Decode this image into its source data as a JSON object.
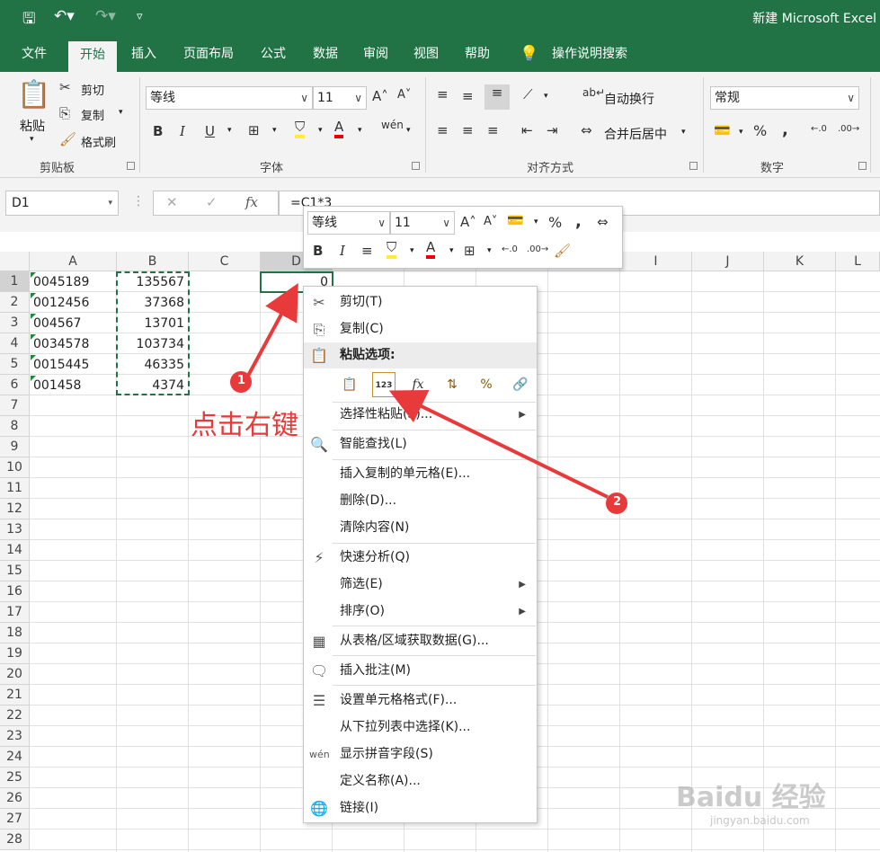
{
  "titlebar": {
    "title": "新建 Microsoft Excel",
    "save_icon": "save-icon",
    "undo_icon": "undo-icon",
    "redo_icon": "redo-icon",
    "customize_icon": "customize-icon"
  },
  "tabs": [
    "文件",
    "开始",
    "插入",
    "页面布局",
    "公式",
    "数据",
    "审阅",
    "视图",
    "帮助"
  ],
  "tell_me": "操作说明搜索",
  "ribbon": {
    "clipboard": {
      "paste": "粘贴",
      "cut": "剪切",
      "copy": "复制",
      "format_painter": "格式刷",
      "label": "剪贴板"
    },
    "font": {
      "name": "等线",
      "size": "11",
      "label": "字体",
      "bold": "B",
      "italic": "I",
      "underline": "U"
    },
    "alignment": {
      "wrap": "自动换行",
      "merge": "合并后居中",
      "label": "对齐方式"
    },
    "number": {
      "format": "常规",
      "percent": "%",
      "comma": ",",
      "label": "数字"
    }
  },
  "formula_bar": {
    "name_box": "D1",
    "formula": "=C1*3",
    "cancel": "✕",
    "enter": "✓",
    "fx": "fx"
  },
  "columns": [
    "A",
    "B",
    "C",
    "D",
    "E",
    "F",
    "G",
    "H",
    "I",
    "J",
    "K",
    "L"
  ],
  "rows": [
    "1",
    "2",
    "3",
    "4",
    "5",
    "6",
    "7",
    "8",
    "9",
    "10",
    "11",
    "12",
    "13",
    "14",
    "15",
    "16",
    "17",
    "18",
    "19",
    "20",
    "21",
    "22",
    "23",
    "24",
    "25",
    "26",
    "27",
    "28"
  ],
  "cells": {
    "A": [
      "0045189",
      "0012456",
      "004567",
      "0034578",
      "0015445",
      "001458"
    ],
    "B": [
      "135567",
      "37368",
      "13701",
      "103734",
      "46335",
      "4374"
    ],
    "D1": "0"
  },
  "mini_toolbar": {
    "font": "等线",
    "size": "11",
    "bold": "B",
    "italic": "I",
    "percent": "%",
    "comma": ","
  },
  "context_menu": {
    "cut": "剪切(T)",
    "copy": "复制(C)",
    "paste_options": "粘贴选项:",
    "paste_special": "选择性粘贴(S)...",
    "smart_lookup": "智能查找(L)",
    "insert_copied": "插入复制的单元格(E)...",
    "delete": "删除(D)...",
    "clear": "清除内容(N)",
    "quick_analysis": "快速分析(Q)",
    "filter": "筛选(E)",
    "sort": "排序(O)",
    "get_data": "从表格/区域获取数据(G)...",
    "insert_comment": "插入批注(M)",
    "format_cells": "设置单元格格式(F)...",
    "pick_list": "从下拉列表中选择(K)...",
    "phonetic": "显示拼音字段(S)",
    "define_name": "定义名称(A)...",
    "link": "链接(I)"
  },
  "annotations": {
    "step1": "1",
    "step2": "2",
    "caption": "点击右键",
    "arrow_color": "#e83a3a"
  },
  "watermark": {
    "brand": "Baidu 经验",
    "url": "jingyan.baidu.com"
  },
  "colors": {
    "excel_green": "#217346",
    "ribbon_bg": "#f3f3f3",
    "annotation_red": "#e83a3a"
  }
}
